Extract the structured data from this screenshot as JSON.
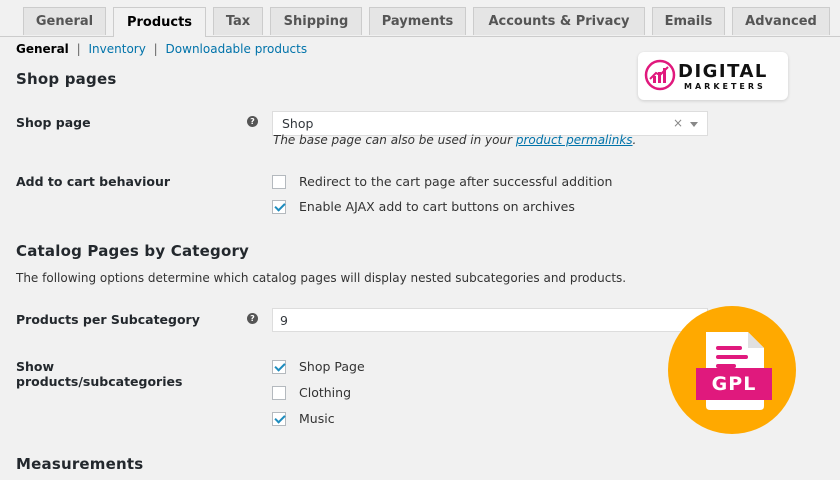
{
  "tabs": [
    {
      "label": "General"
    },
    {
      "label": "Products"
    },
    {
      "label": "Tax"
    },
    {
      "label": "Shipping"
    },
    {
      "label": "Payments"
    },
    {
      "label": "Accounts & Privacy"
    },
    {
      "label": "Emails"
    },
    {
      "label": "Advanced"
    }
  ],
  "subnav": {
    "current": "General",
    "links": [
      "Inventory",
      "Downloadable products"
    ],
    "separator": "|"
  },
  "shop_pages": {
    "heading": "Shop pages",
    "shop_page_label": "Shop page",
    "shop_page_value": "Shop",
    "shop_page_clear": "×",
    "desc_prefix": "The base page can also be used in your ",
    "desc_link": "product permalinks",
    "desc_suffix": ".",
    "cart_label": "Add to cart behaviour",
    "cart_options": [
      {
        "label": "Redirect to the cart page after successful addition",
        "checked": false
      },
      {
        "label": "Enable AJAX add to cart buttons on archives",
        "checked": true
      }
    ]
  },
  "catalog": {
    "heading": "Catalog Pages by Category",
    "description": "The following options determine which catalog pages will display nested subcategories and products.",
    "per_sub_label": "Products per Subcategory",
    "per_sub_value": "9",
    "show_label_line1": "Show",
    "show_label_line2": "products/subcategories",
    "show_options": [
      {
        "label": "Shop Page",
        "checked": true
      },
      {
        "label": "Clothing",
        "checked": false
      },
      {
        "label": "Music",
        "checked": true
      }
    ]
  },
  "measurements": {
    "heading": "Measurements"
  },
  "help_icon": "?",
  "logo": {
    "word1": "DIGITAL",
    "word2": "MARKETERS",
    "mark_icon": "bar-chart-icon",
    "brand_color": "#e0197d"
  },
  "badge": {
    "text": "GPL",
    "icon": "document-icon",
    "circle_color": "#ffa900",
    "doc_color": "#e0197d"
  },
  "colors": {
    "link": "#0073aa",
    "checkmark": "#1e8cbe"
  }
}
